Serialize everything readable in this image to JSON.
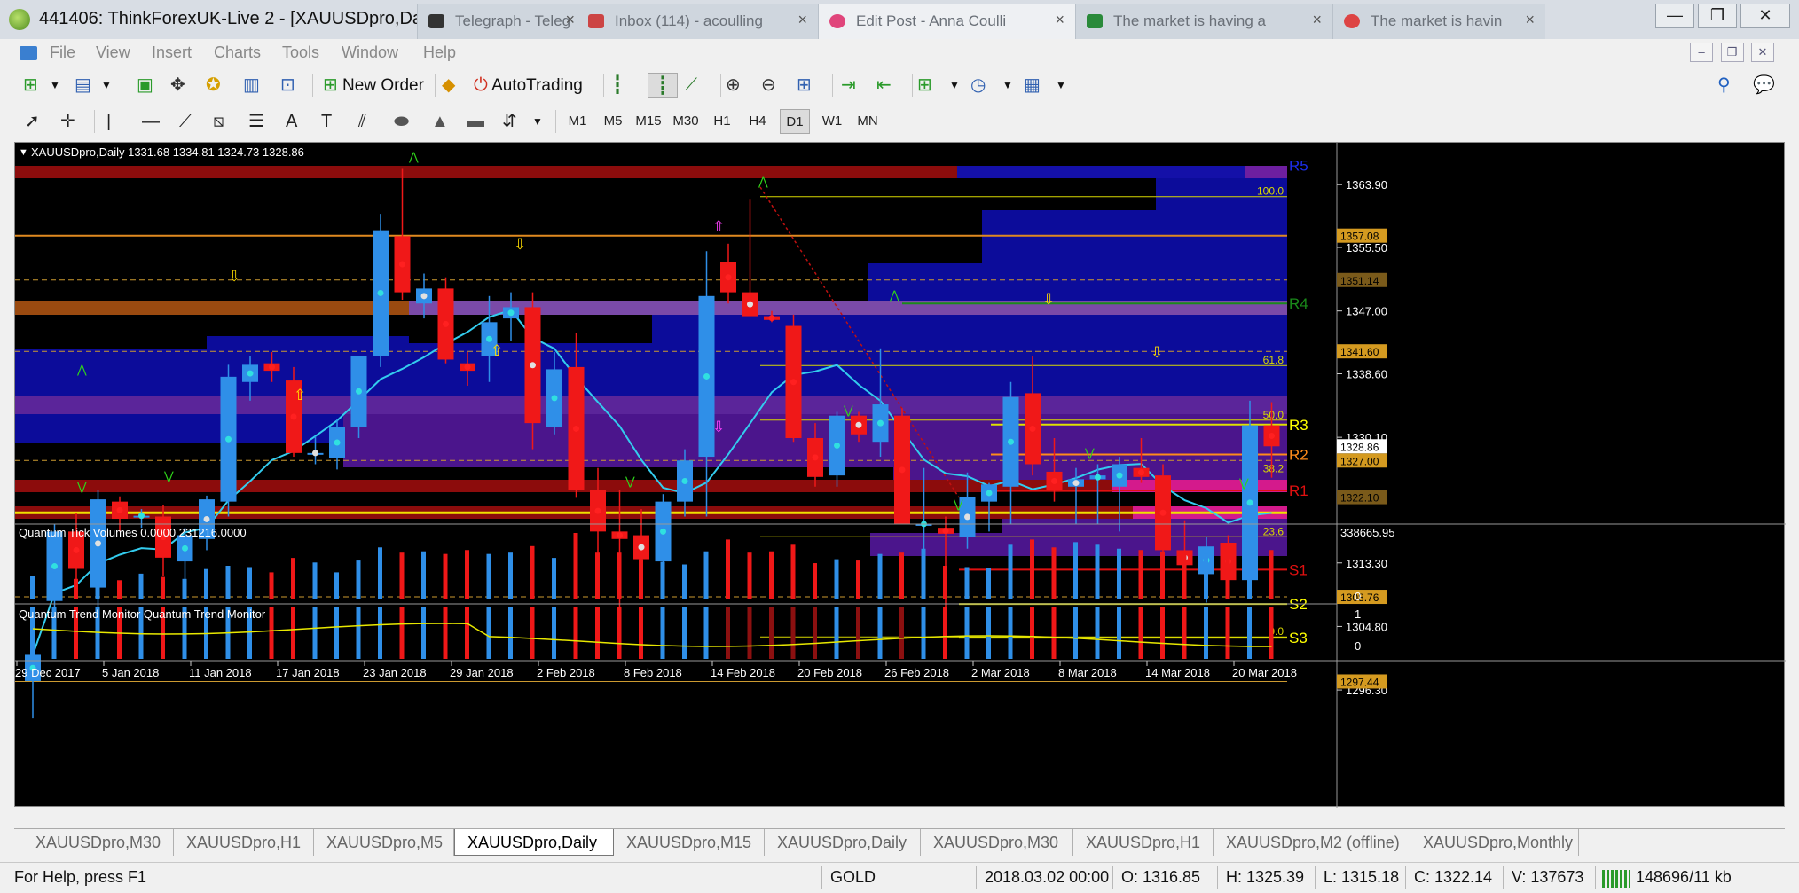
{
  "window": {
    "title": "441406: ThinkForexUK-Live 2 - [XAUUSDpro,Daily]",
    "browser_tabs": [
      {
        "label": "Telegraph - Teleg",
        "color": "#cc3344"
      },
      {
        "label": "Inbox (114) - acoulling",
        "color": "#c44"
      },
      {
        "label": "Edit Post - Anna Coulli",
        "color": "#e0457b"
      },
      {
        "label": "The market is having a",
        "color": "#2a8a3a"
      },
      {
        "label": "The market is havin",
        "color": "#dd4444"
      }
    ],
    "buttons": {
      "minimize": "—",
      "restore": "❐",
      "close": "✕"
    }
  },
  "menu": [
    "File",
    "View",
    "Insert",
    "Charts",
    "Tools",
    "Window",
    "Help"
  ],
  "toolbar": {
    "new_order": "New Order",
    "autotrading": "AutoTrading",
    "timeframes": [
      "M1",
      "M5",
      "M15",
      "M30",
      "H1",
      "H4",
      "D1",
      "W1",
      "MN"
    ],
    "active_timeframe": "D1"
  },
  "chart": {
    "info_line": "XAUUSDpro,Daily  1331.68 1334.81 1324.73 1328.86",
    "indicator1_label": "Quantum Tick Volumes 0.0000 231216.0000",
    "indicator2_label": "Quantum Trend Monitor  Quantum Trend Monitor",
    "volume_axis_top": "338665.95",
    "volume_axis_zero": "0",
    "trend_axis_one": "1",
    "trend_axis_zero": "0",
    "current_price": "1328.86"
  },
  "chart_data": {
    "type": "candlestick",
    "symbol": "XAUUSDpro",
    "timeframe": "Daily",
    "price_axis_labels": [
      "1363.90",
      "1355.50",
      "1347.00",
      "1338.60",
      "1330.10",
      "1313.30",
      "1304.80",
      "1296.30"
    ],
    "price_range": [
      1292,
      1369.5
    ],
    "boxed_levels": [
      {
        "price": 1357.08,
        "label": "1357.08"
      },
      {
        "price": 1351.14,
        "label": "1351.14"
      },
      {
        "price": 1341.6,
        "label": "1341.60"
      },
      {
        "price": 1327.0,
        "label": "1327.00"
      },
      {
        "price": 1322.1,
        "label": "1322.10"
      },
      {
        "price": 1308.76,
        "label": "1308.76"
      },
      {
        "price": 1297.44,
        "label": "1297.44"
      }
    ],
    "pivot_labels": [
      {
        "label": "R5",
        "price": 1366.5,
        "color": "#1b2de8"
      },
      {
        "label": "R4",
        "price": 1348.0,
        "color": "#1a8a1a"
      },
      {
        "label": "R3",
        "price": 1331.8,
        "color": "#ffff00"
      },
      {
        "label": "R2",
        "price": 1327.8,
        "color": "#ff8c1a"
      },
      {
        "label": "R1",
        "price": 1323.0,
        "color": "#e01010"
      },
      {
        "label": "S1",
        "price": 1312.4,
        "color": "#e01010"
      },
      {
        "label": "S2",
        "price": 1307.8,
        "color": "#ffff00"
      },
      {
        "label": "S3",
        "price": 1303.3,
        "color": "#ffff00"
      }
    ],
    "fib_levels": [
      {
        "label": "100.0",
        "price": 1362.3
      },
      {
        "label": "61.8",
        "price": 1339.7
      },
      {
        "label": "50.0",
        "price": 1332.4
      },
      {
        "label": "38.2",
        "price": 1325.2
      },
      {
        "label": "23.6",
        "price": 1316.8
      },
      {
        "label": "0.0",
        "price": 1303.4
      }
    ],
    "date_labels": [
      "29 Dec 2017",
      "5 Jan 2018",
      "11 Jan 2018",
      "17 Jan 2018",
      "23 Jan 2018",
      "29 Jan 2018",
      "2 Feb 2018",
      "8 Feb 2018",
      "14 Feb 2018",
      "20 Feb 2018",
      "26 Feb 2018",
      "2 Mar 2018",
      "8 Mar 2018",
      "14 Mar 2018",
      "20 Mar 2018"
    ],
    "candles": [
      {
        "o": 1297.5,
        "h": 1301.0,
        "l": 1292.5,
        "c": 1301.0
      },
      {
        "o": 1308.2,
        "h": 1318.5,
        "l": 1306.5,
        "c": 1317.5
      },
      {
        "o": 1317.5,
        "h": 1320.0,
        "l": 1309.5,
        "c": 1312.5
      },
      {
        "o": 1310.0,
        "h": 1323.0,
        "l": 1306.5,
        "c": 1321.8
      },
      {
        "o": 1321.5,
        "h": 1322.2,
        "l": 1317.5,
        "c": 1319.2
      },
      {
        "o": 1319.6,
        "h": 1320.5,
        "l": 1318.0,
        "c": 1319.6
      },
      {
        "o": 1319.5,
        "h": 1321.0,
        "l": 1311.5,
        "c": 1314.0
      },
      {
        "o": 1313.5,
        "h": 1318.0,
        "l": 1309.5,
        "c": 1317.0
      },
      {
        "o": 1316.5,
        "h": 1322.3,
        "l": 1315.0,
        "c": 1321.8
      },
      {
        "o": 1321.5,
        "h": 1339.8,
        "l": 1319.5,
        "c": 1338.2
      },
      {
        "o": 1337.5,
        "h": 1341.0,
        "l": 1335.0,
        "c": 1339.8
      },
      {
        "o": 1340.0,
        "h": 1341.5,
        "l": 1337.5,
        "c": 1339.0
      },
      {
        "o": 1337.7,
        "h": 1339.5,
        "l": 1327.5,
        "c": 1328.0
      },
      {
        "o": 1328.0,
        "h": 1330.2,
        "l": 1326.5,
        "c": 1328.0
      },
      {
        "o": 1327.3,
        "h": 1332.5,
        "l": 1325.8,
        "c": 1331.5
      },
      {
        "o": 1331.5,
        "h": 1341.0,
        "l": 1330.0,
        "c": 1341.0
      },
      {
        "o": 1341.0,
        "h": 1360.0,
        "l": 1339.5,
        "c": 1357.8
      },
      {
        "o": 1357.0,
        "h": 1366.0,
        "l": 1348.5,
        "c": 1349.5
      },
      {
        "o": 1348.0,
        "h": 1352.0,
        "l": 1346.0,
        "c": 1350.0
      },
      {
        "o": 1350.0,
        "h": 1351.5,
        "l": 1340.0,
        "c": 1340.5
      },
      {
        "o": 1340.0,
        "h": 1341.5,
        "l": 1337.0,
        "c": 1339.0
      },
      {
        "o": 1341.0,
        "h": 1349.0,
        "l": 1337.5,
        "c": 1345.5
      },
      {
        "o": 1346.0,
        "h": 1349.5,
        "l": 1343.0,
        "c": 1347.5
      },
      {
        "o": 1347.5,
        "h": 1349.5,
        "l": 1328.5,
        "c": 1332.0
      },
      {
        "o": 1331.5,
        "h": 1341.5,
        "l": 1330.5,
        "c": 1339.2
      },
      {
        "o": 1339.5,
        "h": 1344.0,
        "l": 1322.0,
        "c": 1323.0
      },
      {
        "o": 1323.0,
        "h": 1326.0,
        "l": 1314.5,
        "c": 1317.5
      },
      {
        "o": 1317.5,
        "h": 1323.0,
        "l": 1305.5,
        "c": 1316.5
      },
      {
        "o": 1317.0,
        "h": 1320.5,
        "l": 1312.0,
        "c": 1313.8
      },
      {
        "o": 1313.5,
        "h": 1322.5,
        "l": 1312.5,
        "c": 1321.5
      },
      {
        "o": 1321.5,
        "h": 1328.5,
        "l": 1319.5,
        "c": 1327.0
      },
      {
        "o": 1327.5,
        "h": 1355.0,
        "l": 1319.5,
        "c": 1349.0
      },
      {
        "o": 1353.5,
        "h": 1356.0,
        "l": 1348.0,
        "c": 1349.5
      },
      {
        "o": 1349.5,
        "h": 1362.0,
        "l": 1346.5,
        "c": 1346.3
      },
      {
        "o": 1346.3,
        "h": 1347.0,
        "l": 1345.5,
        "c": 1345.8
      },
      {
        "o": 1345.0,
        "h": 1346.5,
        "l": 1329.5,
        "c": 1330.0
      },
      {
        "o": 1330.0,
        "h": 1332.0,
        "l": 1323.5,
        "c": 1324.8
      },
      {
        "o": 1325.0,
        "h": 1333.5,
        "l": 1323.5,
        "c": 1333.0
      },
      {
        "o": 1333.0,
        "h": 1333.5,
        "l": 1329.5,
        "c": 1330.5
      },
      {
        "o": 1329.5,
        "h": 1342.0,
        "l": 1327.5,
        "c": 1334.5
      },
      {
        "o": 1333.0,
        "h": 1334.0,
        "l": 1318.5,
        "c": 1318.5
      },
      {
        "o": 1318.5,
        "h": 1326.0,
        "l": 1313.0,
        "c": 1318.5
      },
      {
        "o": 1318.0,
        "h": 1319.5,
        "l": 1305.5,
        "c": 1317.2
      },
      {
        "o": 1316.8,
        "h": 1325.4,
        "l": 1315.2,
        "c": 1322.1
      },
      {
        "o": 1321.5,
        "h": 1324.0,
        "l": 1317.5,
        "c": 1323.8
      },
      {
        "o": 1323.5,
        "h": 1337.5,
        "l": 1318.5,
        "c": 1335.5
      },
      {
        "o": 1336.0,
        "h": 1341.0,
        "l": 1325.0,
        "c": 1326.5
      },
      {
        "o": 1325.5,
        "h": 1330.0,
        "l": 1321.5,
        "c": 1323.0
      },
      {
        "o": 1323.5,
        "h": 1326.0,
        "l": 1318.5,
        "c": 1324.5
      },
      {
        "o": 1324.5,
        "h": 1326.5,
        "l": 1318.5,
        "c": 1325.0
      },
      {
        "o": 1323.5,
        "h": 1327.5,
        "l": 1317.5,
        "c": 1326.5
      },
      {
        "o": 1326.0,
        "h": 1330.0,
        "l": 1324.0,
        "c": 1324.8
      },
      {
        "o": 1325.0,
        "h": 1326.5,
        "l": 1313.0,
        "c": 1315.0
      },
      {
        "o": 1315.0,
        "h": 1319.0,
        "l": 1309.5,
        "c": 1313.0
      },
      {
        "o": 1311.8,
        "h": 1316.8,
        "l": 1308.0,
        "c": 1315.5
      },
      {
        "o": 1316.0,
        "h": 1317.0,
        "l": 1309.0,
        "c": 1311.0
      },
      {
        "o": 1311.0,
        "h": 1335.0,
        "l": 1309.0,
        "c": 1331.7
      },
      {
        "o": 1331.7,
        "h": 1334.8,
        "l": 1324.7,
        "c": 1328.9
      }
    ]
  },
  "chart_tabs": [
    "XAUUSDpro,M30",
    "XAUUSDpro,H1",
    "XAUUSDpro,M5",
    "XAUUSDpro,Daily",
    "XAUUSDpro,M15",
    "XAUUSDpro,Daily",
    "XAUUSDpro,M30",
    "XAUUSDpro,H1",
    "XAUUSDpro,M2 (offline)",
    "XAUUSDpro,Monthly"
  ],
  "active_chart_tab": 3,
  "status": {
    "help": "For Help, press F1",
    "profile": "GOLD",
    "time": "2018.03.02 00:00",
    "open": "O: 1316.85",
    "high": "H: 1325.39",
    "low": "L: 1315.18",
    "close": "C: 1322.14",
    "volume": "V: 137673",
    "traffic": "148696/11 kb"
  },
  "colors": {
    "bull": "#2f8fe8",
    "bear": "#f01818",
    "ma": "#33ccee",
    "fib": "#d8d800",
    "resistance_box": "#8c0c0c",
    "zone_blue": "#0c0c9a",
    "zone_purple": "#4b158c"
  }
}
